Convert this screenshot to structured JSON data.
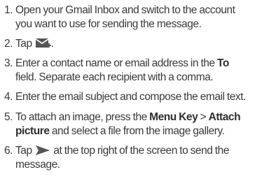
{
  "steps": [
    {
      "number": "1.",
      "line1": "Open your Gmail Inbox and switch to the account",
      "line2": "you want to use for sending the message."
    },
    {
      "number": "2.",
      "pre": "Tap",
      "post": ".",
      "icon": "gmail-compose-icon"
    },
    {
      "number": "3.",
      "line1_pre": "Enter a contact name or email address in the",
      "line1_bold": "To",
      "line2": "field. Separate each recipient with a comma."
    },
    {
      "number": "4.",
      "line1": "Enter the email subject and compose the email text."
    },
    {
      "number": "5.",
      "line1_pre": "To attach an image, press the",
      "line1_bold1": "Menu Key",
      "line1_sep": ">",
      "line1_bold2": "Attach",
      "line2_bold": "picture",
      "line2_post": "and select a file from the image gallery."
    },
    {
      "number": "6.",
      "line1_pre": "Tap",
      "line1_post": "at the top right of the screen to send the",
      "line2": "message.",
      "icon": "send-arrow-icon"
    }
  ],
  "colors": {
    "text": "#3a3a3a",
    "icon": "#555555"
  }
}
